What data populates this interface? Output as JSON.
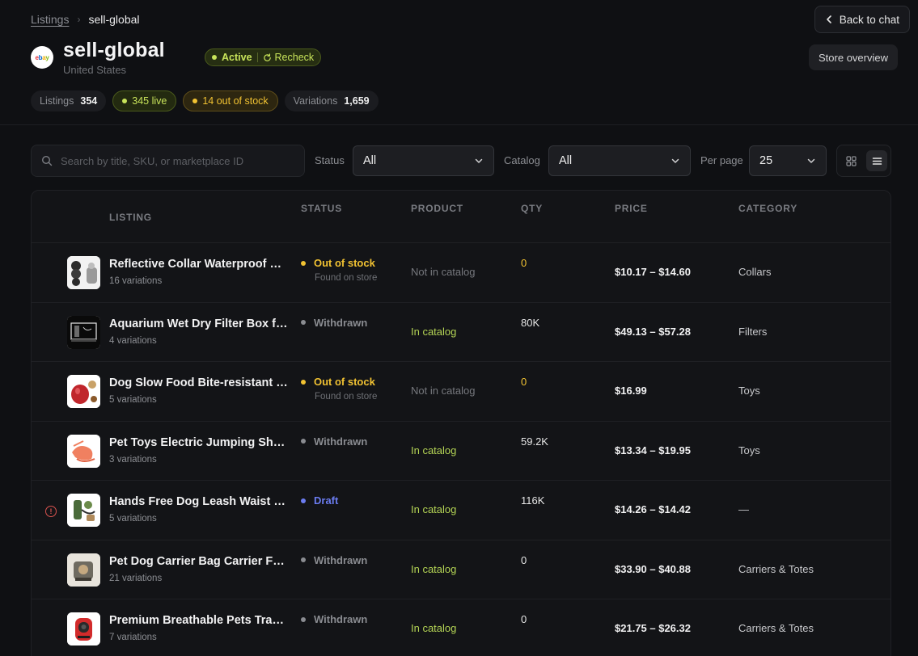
{
  "breadcrumb": {
    "root": "Listings",
    "current": "sell-global"
  },
  "header": {
    "back_label": "Back to chat",
    "overview_label": "Store overview",
    "store_name": "sell-global",
    "country": "United States",
    "logo_text": "ebay",
    "status": "Active",
    "recheck": "Recheck"
  },
  "stats": {
    "listings_label": "Listings",
    "listings_value": "354",
    "live": "345 live",
    "out_of_stock": "14 out of stock",
    "variations_label": "Variations",
    "variations_value": "1,659"
  },
  "filters": {
    "search_placeholder": "Search by title, SKU, or marketplace ID",
    "status_label": "Status",
    "status_value": "All",
    "catalog_label": "Catalog",
    "catalog_value": "All",
    "perpage_label": "Per page",
    "perpage_value": "25"
  },
  "table": {
    "columns": {
      "listing": "LISTING",
      "status": "STATUS",
      "product": "PRODUCT",
      "qty": "QTY",
      "price": "PRICE",
      "category": "CATEGORY"
    },
    "rows": [
      {
        "title": "Reflective Collar Waterproof Harness",
        "variations": "16 variations",
        "status": "Out of stock",
        "status_sub": "Found on store",
        "status_color": "#f1c232",
        "product": "Not in catalog",
        "in_catalog": false,
        "qty": "0",
        "qty_color": "#f1c232",
        "price": "$10.17 – $14.60",
        "category": "Collars",
        "warning": false,
        "thumb": "collar"
      },
      {
        "title": "Aquarium Wet Dry Filter Box for Fish Tank",
        "variations": "4 variations",
        "status": "Withdrawn",
        "status_sub": "",
        "status_color": "#8a8c91",
        "product": "In catalog",
        "in_catalog": true,
        "qty": "80K",
        "qty_color": "#e6e6e6",
        "price": "$49.13 – $57.28",
        "category": "Filters",
        "warning": false,
        "thumb": "aquarium"
      },
      {
        "title": "Dog Slow Food Bite-resistant Toy Ball",
        "variations": "5 variations",
        "status": "Out of stock",
        "status_sub": "Found on store",
        "status_color": "#f1c232",
        "product": "Not in catalog",
        "in_catalog": false,
        "qty": "0",
        "qty_color": "#f1c232",
        "price": "$16.99",
        "category": "Toys",
        "warning": false,
        "thumb": "toy"
      },
      {
        "title": "Pet Toys Electric Jumping Shrimp Fish",
        "variations": "3 variations",
        "status": "Withdrawn",
        "status_sub": "",
        "status_color": "#8a8c91",
        "product": "In catalog",
        "in_catalog": true,
        "qty": "59.2K",
        "qty_color": "#e6e6e6",
        "price": "$13.34 – $19.95",
        "category": "Toys",
        "warning": false,
        "thumb": "shrimp"
      },
      {
        "title": "Hands Free Dog Leash Waist Belt",
        "variations": "5 variations",
        "status": "Draft",
        "status_sub": "",
        "status_color": "#6b7cf0",
        "product": "In catalog",
        "in_catalog": true,
        "qty": "116K",
        "qty_color": "#e6e6e6",
        "price": "$14.26 – $14.42",
        "category": "—",
        "warning": true,
        "thumb": "leash"
      },
      {
        "title": "Pet Dog Carrier Bag Carrier For Dogs",
        "variations": "21 variations",
        "status": "Withdrawn",
        "status_sub": "",
        "status_color": "#8a8c91",
        "product": "In catalog",
        "in_catalog": true,
        "qty": "0",
        "qty_color": "#e6e6e6",
        "price": "$33.90 – $40.88",
        "category": "Carriers & Totes",
        "warning": false,
        "thumb": "carrier"
      },
      {
        "title": "Premium Breathable Pets Travel Backpack",
        "variations": "7 variations",
        "status": "Withdrawn",
        "status_sub": "",
        "status_color": "#8a8c91",
        "product": "In catalog",
        "in_catalog": true,
        "qty": "0",
        "qty_color": "#e6e6e6",
        "price": "$21.75 – $26.32",
        "category": "Carriers & Totes",
        "warning": false,
        "thumb": "backpack"
      }
    ]
  }
}
